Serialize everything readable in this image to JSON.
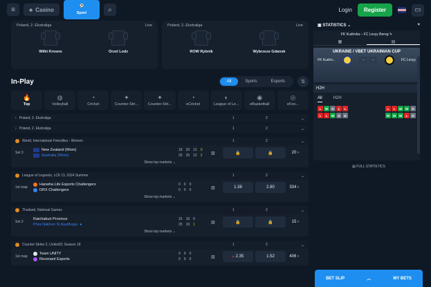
{
  "topbar": {
    "casino_label": "Casino",
    "sport_label": "Sport",
    "login_label": "Login",
    "register_label": "Register"
  },
  "featured": [
    {
      "league": "Poland, 2. Ekstraliga",
      "status": "Live",
      "home": "Wilki Krosno",
      "away": "Orzel Lodz"
    },
    {
      "league": "Poland, 2. Ekstraliga",
      "status": "Live",
      "home": "ROW Rybnik",
      "away": "Wybrzeze Gdansk"
    }
  ],
  "inplay": {
    "title": "In-Play",
    "tabs": [
      "All",
      "Sports",
      "Esports"
    ]
  },
  "sports": [
    "Top",
    "Volleyball",
    "Cricket",
    "Counter-Stri...",
    "Counter-Stri...",
    "eCricket",
    "League of Le...",
    "eBasketball",
    "eFoo..."
  ],
  "leagues_top": [
    {
      "name": "Poland, 2. Ekstraliga",
      "c1": "1",
      "c2": "2"
    },
    {
      "name": "Poland, 2. Ekstraliga",
      "c1": "1",
      "c2": "2"
    }
  ],
  "matches": [
    {
      "league": "World, International Friendlies - Women",
      "c1": "1",
      "c2": "2",
      "period": "Set 3",
      "home": "New Zealand (Wom)",
      "away": "Australia (Wom)",
      "home_scores": [
        "18",
        "20",
        "12",
        "0"
      ],
      "away_scores": [
        "25",
        "25",
        "12",
        "2"
      ],
      "odd1": "",
      "odd2": "",
      "more": "20",
      "show": "Show top markets"
    },
    {
      "league": "League of Legends, LCK CL 2024 Summer",
      "c1": "1",
      "c2": "2",
      "period": "1st map",
      "home": "Hanwha Life Esports Challengers",
      "away": "DRX Challengers",
      "home_scores": [
        "0",
        "0",
        "0"
      ],
      "away_scores": [
        "0",
        "0",
        "0"
      ],
      "odd1": "1.38",
      "odd2": "2.80",
      "more": "334",
      "show": "Show top markets"
    },
    {
      "league": "Thailand, National Games",
      "c1": "1",
      "c2": "2",
      "period": "Set 2",
      "home": "Ratchaburi Province",
      "away": "Phra Nakhon Si Ayutthaya",
      "home_scores": [
        "15",
        "18",
        "0"
      ],
      "away_scores": [
        "25",
        "19",
        "1"
      ],
      "odd1": "",
      "odd2": "",
      "more": "15",
      "show": "Show top markets"
    },
    {
      "league": "Counter-Strike 2, United21 Season 18",
      "c1": "1",
      "c2": "2",
      "period": "1st map",
      "home": "Team UNITY",
      "away": "Revenant Esports",
      "home_scores": [
        "0",
        "0",
        "0"
      ],
      "away_scores": [
        "0",
        "0",
        "0"
      ],
      "odd1": "2.35",
      "odd2": "1.52",
      "more": "406",
      "show": ""
    }
  ],
  "sidebar": {
    "statistics_label": "STATISTICS",
    "match_title": "FK Kudrivka – FC Levyy Bereg",
    "cup": "UKRAINE / VBET UKRAINIAN CUP",
    "home_short": "FK Kudriv...",
    "away_short": "FC Levyy",
    "score_home": "-",
    "score_away": "-",
    "h2h_label": "H2H",
    "all_label": "All",
    "h2h_tab": "H2H",
    "home_form_1": [
      "L",
      "W",
      "D",
      "L",
      "L"
    ],
    "home_form_2": [
      "L",
      "L",
      "W",
      "D",
      "D"
    ],
    "away_form_1": [
      "L",
      "L",
      "W",
      "W",
      "D"
    ],
    "away_form_2": [
      "W",
      "W",
      "W",
      "L",
      "D"
    ],
    "full_stats": "FULL STATISTICS"
  },
  "betslip": {
    "label": "BET SLIP",
    "mybets": "MY BETS"
  }
}
